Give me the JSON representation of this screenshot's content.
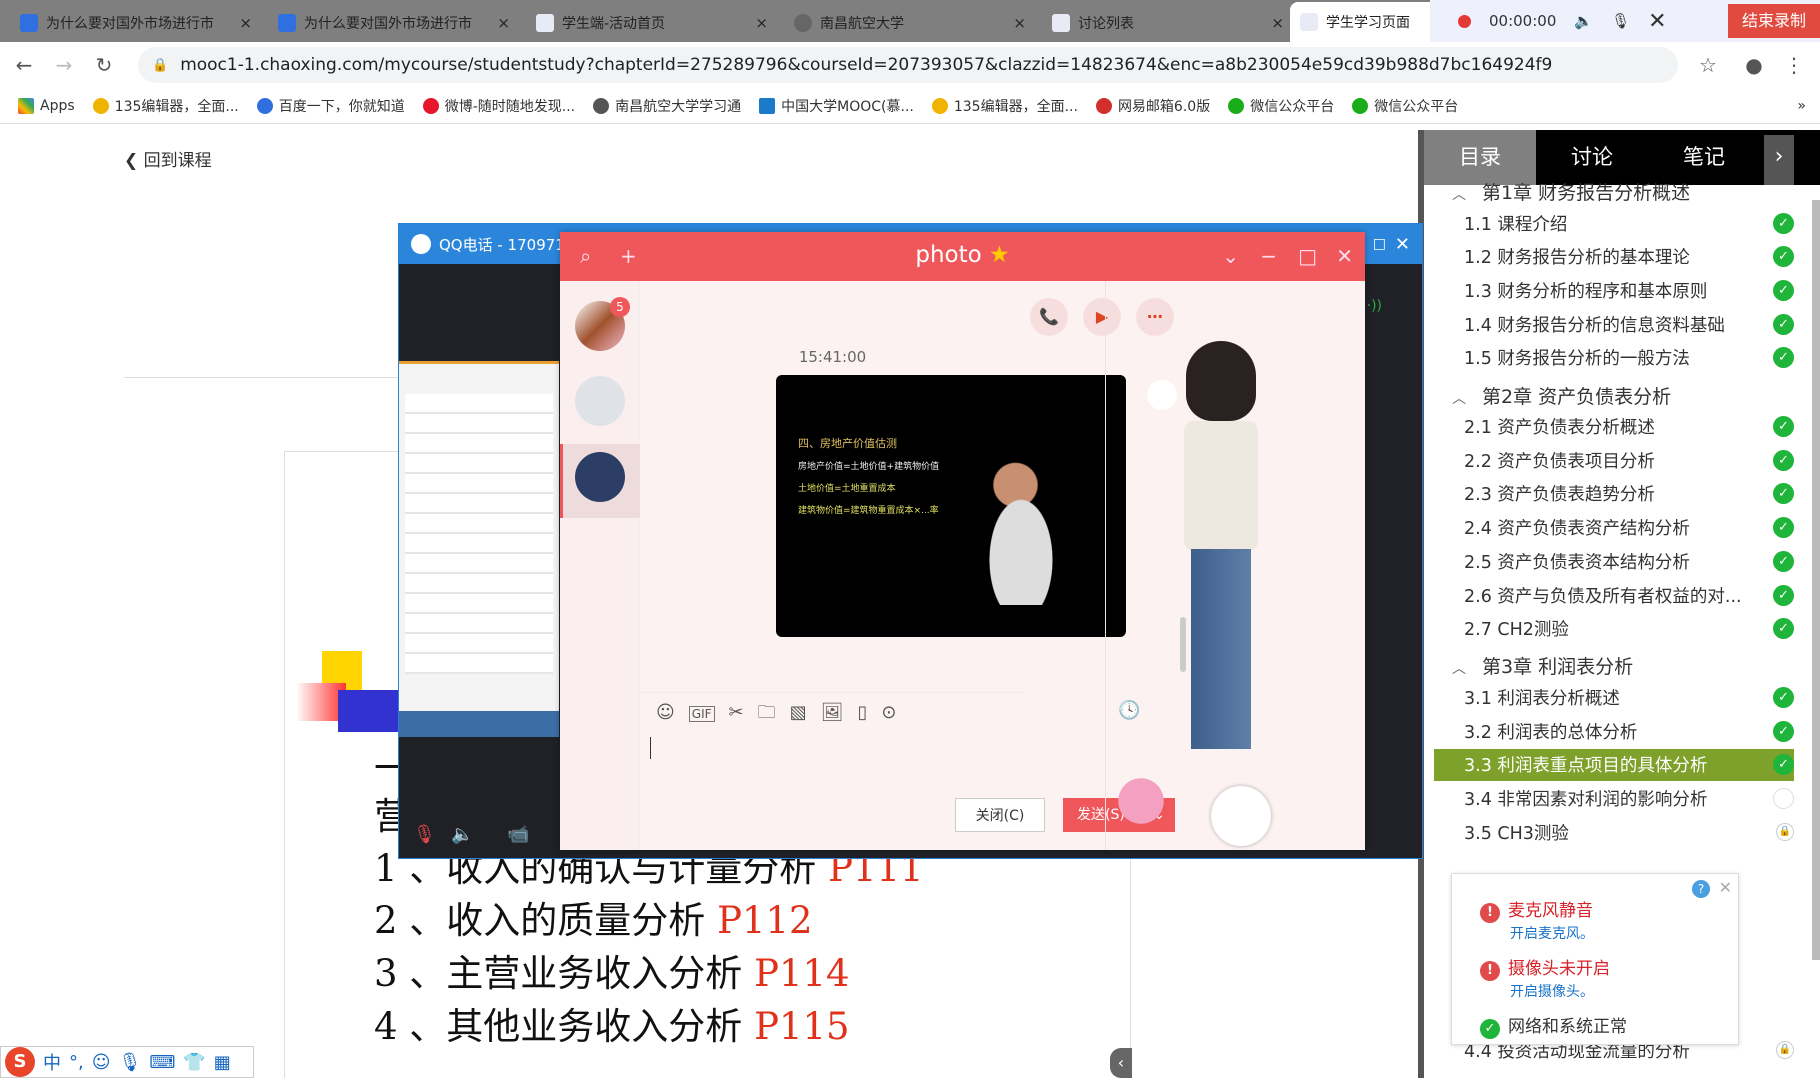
{
  "browser": {
    "tabs": [
      {
        "title": "为什么要对国外市场进行市",
        "close": "×"
      },
      {
        "title": "为什么要对国外市场进行市",
        "close": "×"
      },
      {
        "title": "学生端-活动首页",
        "close": "×"
      },
      {
        "title": "南昌航空大学",
        "close": "×"
      },
      {
        "title": "讨论列表",
        "close": "×"
      },
      {
        "title": "学生学习页面",
        "active": true
      }
    ],
    "url": "mooc1-1.chaoxing.com/mycourse/studentstudy?chapterId=275289796&courseId=207393057&clazzid=14823674&enc=a8b230054e59cd39b988d7bc164924f9",
    "bookmarks": [
      "Apps",
      "135编辑器，全面...",
      "百度一下，你就知道",
      "微博-随时随地发现...",
      "南昌航空大学学习通",
      "中国大学MOOC(慕...",
      "135编辑器，全面...",
      "网易邮箱6.0版",
      "微信公众平台",
      "微信公众平台"
    ],
    "more": "»"
  },
  "recorder": {
    "time": "00:00:00",
    "end_label": "结束录制"
  },
  "page": {
    "back": "回到课程"
  },
  "slide": {
    "lines": [
      {
        "text": "1 、收入的确认与计量分析 ",
        "page": "P111"
      },
      {
        "text": "2 、收入的质量分析 ",
        "page": "P112"
      },
      {
        "text": "3 、主营业务收入分析 ",
        "page": "P114"
      },
      {
        "text": "4 、其他业务收入分析 ",
        "page": "P115"
      }
    ],
    "partial": [
      "一",
      "营"
    ]
  },
  "sidebar": {
    "tabs": [
      "目录",
      "讨论",
      "笔记"
    ],
    "chapters": [
      {
        "title": "第1章 财务报告分析概述",
        "items": [
          {
            "label": "1.1 课程介绍",
            "status": "done"
          },
          {
            "label": "1.2 财务报告分析的基本理论",
            "status": "done"
          },
          {
            "label": "1.3 财务分析的程序和基本原则",
            "status": "done"
          },
          {
            "label": "1.4 财务报告分析的信息资料基础",
            "status": "done"
          },
          {
            "label": "1.5 财务报告分析的一般方法",
            "status": "done"
          }
        ]
      },
      {
        "title": "第2章 资产负债表分析",
        "items": [
          {
            "label": "2.1 资产负债表分析概述",
            "status": "done"
          },
          {
            "label": "2.2 资产负债表项目分析",
            "status": "done"
          },
          {
            "label": "2.3 资产负债表趋势分析",
            "status": "done"
          },
          {
            "label": "2.4 资产负债表资产结构分析",
            "status": "done"
          },
          {
            "label": "2.5 资产负债表资本结构分析",
            "status": "done"
          },
          {
            "label": "2.6 资产与负债及所有者权益的对...",
            "status": "done"
          },
          {
            "label": "2.7 CH2测验",
            "status": "done"
          }
        ]
      },
      {
        "title": "第3章 利润表分析",
        "items": [
          {
            "label": "3.1 利润表分析概述",
            "status": "done"
          },
          {
            "label": "3.2 利润表的总体分析",
            "status": "done"
          },
          {
            "label": "3.3 利润表重点项目的具体分析",
            "status": "done",
            "current": true
          },
          {
            "label": "3.4 非常因素对利润的影响分析",
            "status": "open"
          },
          {
            "label": "3.5 CH3测验",
            "status": "locked"
          }
        ]
      }
    ],
    "hidden_item": "4.4 投资活动现金流量的分析"
  },
  "notify": {
    "mic_title": "麦克风静音",
    "mic_action": "开启麦克风。",
    "cam_title": "摄像头未开启",
    "cam_action": "开启摄像头。",
    "ok": "网络和系统正常"
  },
  "qqcall": {
    "title": "QQ电话 - 170971"
  },
  "chat": {
    "title": "photo",
    "badge": "5",
    "timestamp": "15:41:00",
    "image_text": {
      "heading": "四、房地产价值估测",
      "l1": "房地产价值=土地价值+建筑物价值",
      "l2": "土地价值=土地重置成本",
      "l3": "建筑物价值=建筑物重置成本×...率"
    },
    "close_label": "关闭(C)",
    "send_label": "发送(S)"
  },
  "ime": {
    "label": "中"
  }
}
